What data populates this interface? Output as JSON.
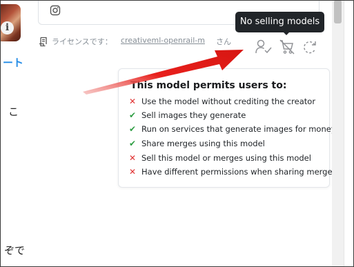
{
  "left_column": {
    "link_text": "ート",
    "char_1": "こ",
    "char_2": "ぞで"
  },
  "license": {
    "prefix": "ライセンスです：",
    "link": "creativeml-openrail-m",
    "suffix": "さん"
  },
  "tooltip": {
    "text": "No selling models"
  },
  "permissions": {
    "title": "This model permits users to:",
    "items": [
      {
        "allowed": false,
        "mark": "✕",
        "text": "Use the model without crediting the creator"
      },
      {
        "allowed": true,
        "mark": "✔",
        "text": "Sell images they generate"
      },
      {
        "allowed": true,
        "mark": "✔",
        "text": "Run on services that generate images for money"
      },
      {
        "allowed": true,
        "mark": "✔",
        "text": "Share merges using this model"
      },
      {
        "allowed": false,
        "mark": "✕",
        "text": "Sell this model or merges using this model"
      },
      {
        "allowed": false,
        "mark": "✕",
        "text": "Have different permissions when sharing merges"
      }
    ]
  },
  "icons": {
    "social": "instagram-icon",
    "license": "document-license-icon",
    "credit": "user-check-icon",
    "selling": "cart-off-icon",
    "merge": "refresh-dashed-icon",
    "info": "info-icon"
  },
  "colors": {
    "disallowed": "#e03131",
    "allowed": "#2f9e44",
    "tooltip_bg": "#212529",
    "annotation_arrow": "#e8201c",
    "link_blue": "#228be6"
  }
}
